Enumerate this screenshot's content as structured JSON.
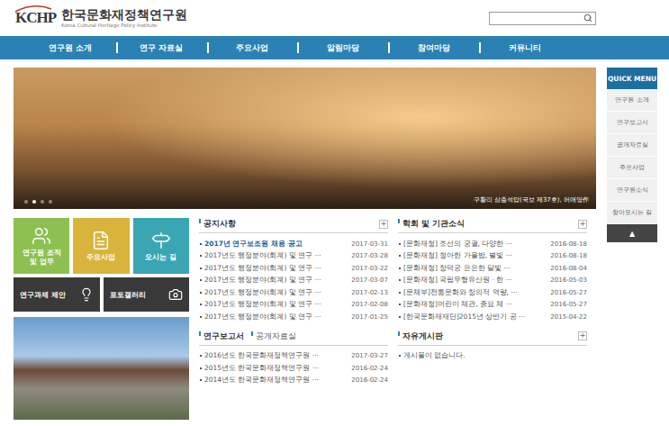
{
  "header": {
    "logo_mark": "KCHP",
    "logo_title": "한국문화재정책연구원",
    "logo_subtitle": "Korea Cultural Heritage Policy Institute"
  },
  "nav": [
    "연구원 소개",
    "연구 자료실",
    "주요사업",
    "알림마당",
    "참여마당",
    "커뮤니티"
  ],
  "hero": {
    "caption": "구황리 삼층석탑(국보 제37호), 허애영作",
    "dots": [
      {
        "selected": false
      },
      {
        "selected": true
      },
      {
        "selected": false
      },
      {
        "selected": false
      }
    ]
  },
  "tiles": [
    {
      "label": "연구원 조직\n및 업무",
      "color": "#8cc152",
      "kind": "people"
    },
    {
      "label": "주요사업",
      "color": "#d9b43c",
      "kind": "document"
    },
    {
      "label": "오시는 길",
      "color": "#3aa6b4",
      "kind": "sign"
    }
  ],
  "buttons": [
    {
      "label": "연구과제 제안",
      "kind": "bulb"
    },
    {
      "label": "포토갤러리",
      "kind": "camera"
    }
  ],
  "notices": {
    "title": "공지사항",
    "more": "+",
    "items": [
      {
        "title": "2017년 연구보조원 채용 공고",
        "date": "2017-03-31",
        "highlight": true
      },
      {
        "title": "2017년도 행정분야(회계) 및 연구 ···",
        "date": "2017-03-28",
        "highlight": false
      },
      {
        "title": "2017년도 행정분야(회계) 및 연구 ···",
        "date": "2017-03-22",
        "highlight": false
      },
      {
        "title": "2017년도 행정분야(회계) 및 연구 ···",
        "date": "2017-03-07",
        "highlight": false
      },
      {
        "title": "2017년도 행정분야(회계) 및 연구 ···",
        "date": "2017-02-13",
        "highlight": false
      },
      {
        "title": "2017년도 행정분야(회계) 및 연구 ···",
        "date": "2017-02-08",
        "highlight": false
      },
      {
        "title": "2017년도 행정분야(회계) 및 연구 ···",
        "date": "2017-01-25",
        "highlight": false
      }
    ]
  },
  "reports": {
    "tabs": [
      {
        "label": "연구보고서",
        "selected": true
      },
      {
        "label": "공개자료실",
        "selected": false
      }
    ],
    "items": [
      {
        "title": "2016년도 한국문화재정책연구원 ···",
        "date": "2017-03-27"
      },
      {
        "title": "2015년도 한국문화재정책연구원 ···",
        "date": "2016-02-24"
      },
      {
        "title": "2014년도 한국문화재정책연구원 ···",
        "date": "2016-02-24"
      }
    ]
  },
  "news": {
    "title": "학회 및 기관소식",
    "more": "+",
    "items": [
      {
        "title": "[문화재청] 조선의 궁궐, 다양한 ···",
        "date": "2016-08-18"
      },
      {
        "title": "[문화재청] 청아한 가을밤, 별빛 ···",
        "date": "2016-08-18"
      },
      {
        "title": "[문화재청] 창덕궁 은은한 달빛 ···",
        "date": "2016-08-04"
      },
      {
        "title": "[문화재청] 국립무형유산원 · 한 ···",
        "date": "2016-05-03"
      },
      {
        "title": "[문체부]전통문화와 창의적 역량, ···",
        "date": "2016-05-27"
      },
      {
        "title": "[문화재청]어린이 체관, 종묘 체 ···",
        "date": "2016-05-27"
      },
      {
        "title": "[한국문화재재단]2015년 상반기 공 ···",
        "date": "2015-04-22"
      }
    ]
  },
  "board": {
    "title": "자유게시판",
    "more": "+",
    "empty": "게시물이 없습니다."
  },
  "quick_menu": {
    "title": "QUICK MENU",
    "items": [
      "연구원 소개",
      "연구보고서",
      "공개자료실",
      "주요사업",
      "연구원소식",
      "찾아오시는 길"
    ],
    "top": "▲"
  }
}
